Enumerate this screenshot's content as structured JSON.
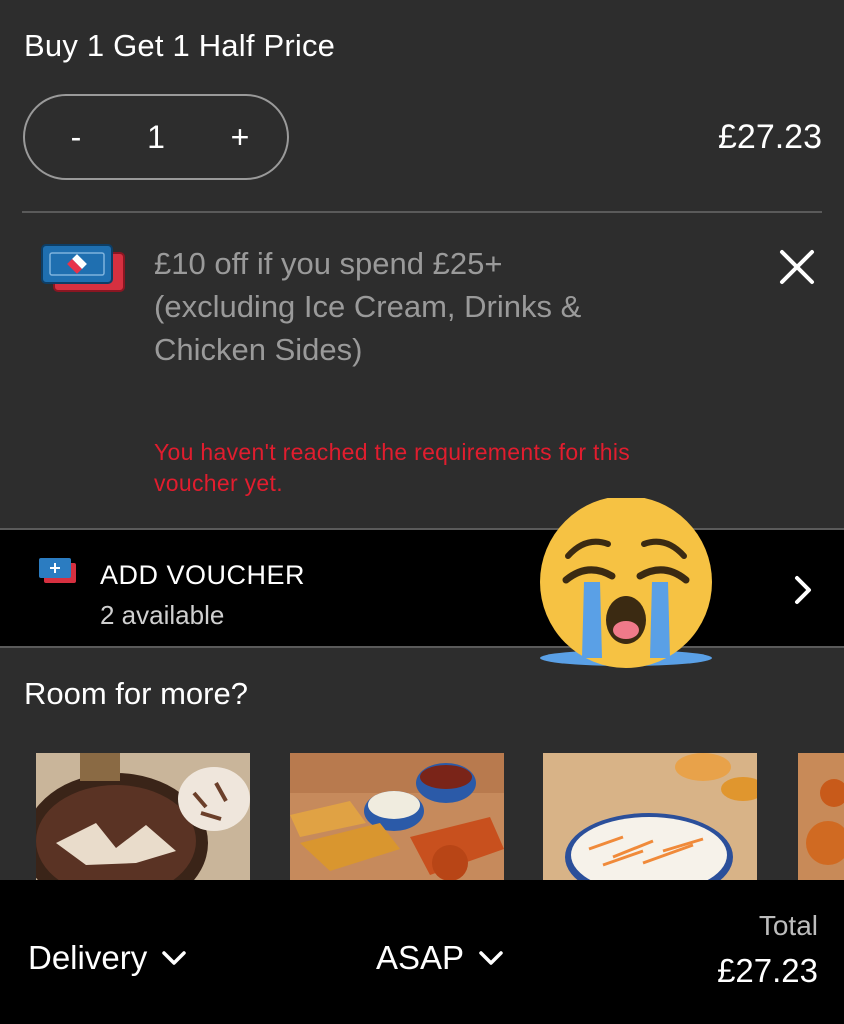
{
  "deal": {
    "title": "Buy 1 Get 1 Half Price",
    "quantity": "1",
    "minus_label": "-",
    "plus_label": "+",
    "price": "£27.23"
  },
  "voucher": {
    "line1": "£10 off if you spend £25+",
    "line2": "(excluding Ice Cream, Drinks &",
    "line3": "Chicken Sides)",
    "error_line1": "You haven't reached the requirements for this",
    "error_line2": "voucher yet.",
    "remove_icon": "close-icon"
  },
  "add_voucher": {
    "label": "ADD VOUCHER",
    "sublabel": "2 available",
    "icon": "voucher-plus-icon"
  },
  "overlay": {
    "emoji": "loudly-crying-face-emoji"
  },
  "more": {
    "title": "Room for more?",
    "products": [
      {
        "name": "ice-cream-tub"
      },
      {
        "name": "chicken-strips-dips"
      },
      {
        "name": "coleslaw"
      },
      {
        "name": "chicken-bites"
      }
    ]
  },
  "footer": {
    "delivery_label": "Delivery",
    "time_label": "ASAP",
    "total_label": "Total",
    "total_price": "£27.23"
  },
  "colors": {
    "background": "#2d2d2d",
    "bar_background": "#000000",
    "error": "#e11d2e",
    "muted_text": "#9a9a9a",
    "divider": "#5a5a5a"
  }
}
